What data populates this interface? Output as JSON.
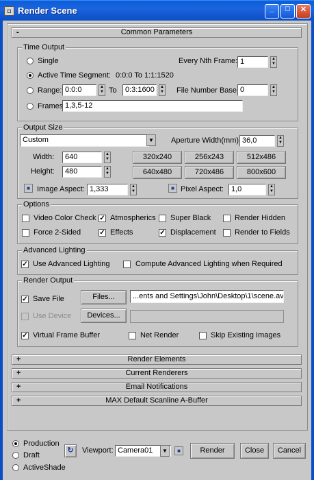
{
  "window": {
    "title": "Render Scene"
  },
  "common": {
    "header": "Common Parameters",
    "time_output": {
      "label": "Time Output",
      "single": "Single",
      "every_nth_label": "Every Nth Frame:",
      "every_nth_value": "1",
      "active_label": "Active Time Segment:",
      "active_value": "0:0:0 To 1:1:1520",
      "range_label": "Range:",
      "range_from": "0:0:0",
      "range_to_label": "To",
      "range_to": "0:3:1600",
      "file_base_label": "File Number Base:",
      "file_base_value": "0",
      "frames_label": "Frames",
      "frames_value": "1,3,5-12",
      "selected": "active"
    },
    "output_size": {
      "label": "Output Size",
      "preset": "Custom",
      "aperture_label": "Aperture Width(mm):",
      "aperture_value": "36,0",
      "width_label": "Width:",
      "width_value": "640",
      "height_label": "Height:",
      "height_value": "480",
      "presets": [
        "320x240",
        "256x243",
        "512x486",
        "640x480",
        "720x486",
        "800x600"
      ],
      "image_aspect_label": "Image Aspect:",
      "image_aspect_value": "1,333",
      "pixel_aspect_label": "Pixel Aspect:",
      "pixel_aspect_value": "1,0"
    },
    "options": {
      "label": "Options",
      "items": [
        {
          "label": "Video Color Check",
          "checked": false
        },
        {
          "label": "Atmospherics",
          "checked": true
        },
        {
          "label": "Super Black",
          "checked": false
        },
        {
          "label": "Render Hidden",
          "checked": false
        },
        {
          "label": "Force 2-Sided",
          "checked": false
        },
        {
          "label": "Effects",
          "checked": true
        },
        {
          "label": "Displacement",
          "checked": true
        },
        {
          "label": "Render to Fields",
          "checked": false
        }
      ]
    },
    "advanced_lighting": {
      "label": "Advanced Lighting",
      "use": "Use Advanced Lighting",
      "use_checked": true,
      "compute": "Compute Advanced Lighting when Required",
      "compute_checked": false
    },
    "render_output": {
      "label": "Render Output",
      "save_file": "Save File",
      "save_file_checked": true,
      "files_button": "Files...",
      "path": "...ents and Settings\\John\\Desktop\\1\\scene.avi",
      "use_device": "Use Device",
      "use_device_checked": false,
      "devices_button": "Devices...",
      "device_value": "",
      "vfb": "Virtual Frame Buffer",
      "vfb_checked": true,
      "net_render": "Net Render",
      "net_render_checked": false,
      "skip_existing": "Skip Existing Images",
      "skip_existing_checked": false
    }
  },
  "rollouts": [
    "Render Elements",
    "Current Renderers",
    "Email Notifications",
    "MAX Default Scanline A-Buffer"
  ],
  "bottom": {
    "modes": [
      "Production",
      "Draft",
      "ActiveShade"
    ],
    "selected_mode": "Production",
    "viewport_label": "Viewport:",
    "viewport_value": "Camera01",
    "render_button": "Render",
    "close_button": "Close",
    "cancel_button": "Cancel"
  },
  "symbols": {
    "collapse": "-",
    "expand": "+",
    "check": "✓",
    "dropdown": "▼",
    "spin_up": "▲",
    "spin_down": "▼",
    "lock": "🔒"
  },
  "colors": {
    "titlebar": "#0b4fc6",
    "panel": "#c8c8c8"
  }
}
